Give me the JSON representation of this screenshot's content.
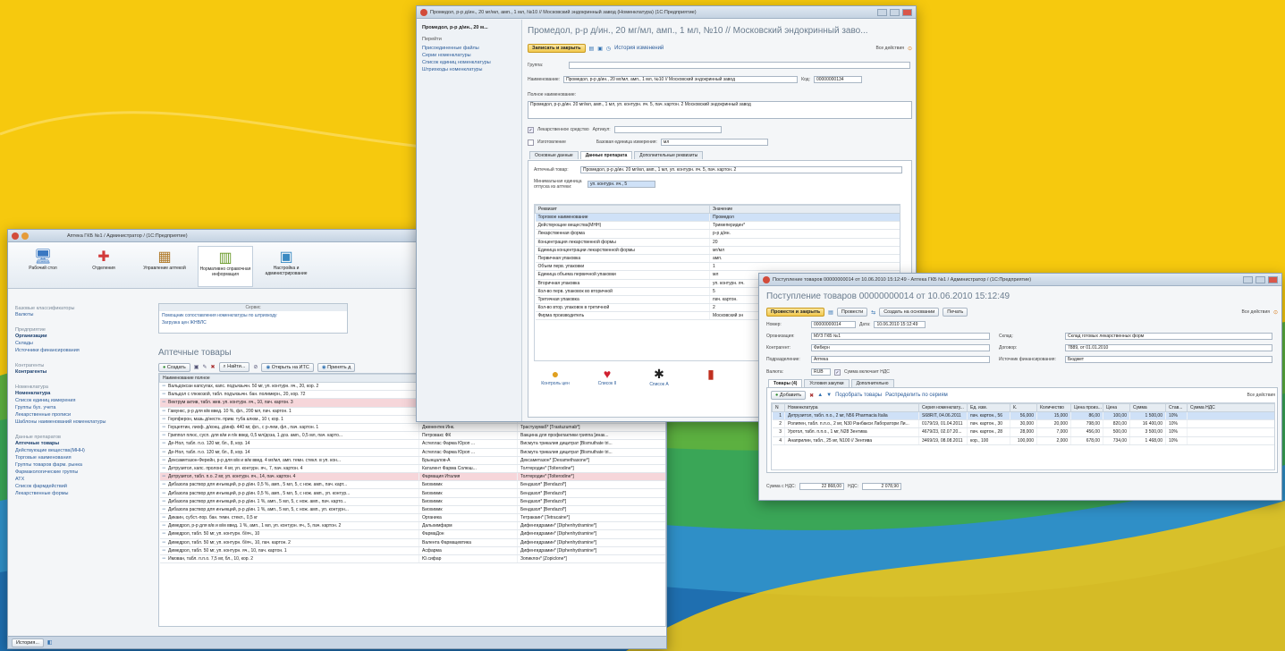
{
  "colors": {
    "bg_yellow": "#f6c90e",
    "bg_green": "#3aa657",
    "bg_blue": "#2f8fc7",
    "selection": "#cfe1f7",
    "pink_row": "#f6d6da"
  },
  "win1": {
    "title": "Аптека ГКБ №1 / Администратор / (1С:Предприятие)",
    "sections": [
      {
        "label": "Рабочий стол",
        "icon": "desktop-icon"
      },
      {
        "label": "Отделения",
        "icon": "medical-cross-icon"
      },
      {
        "label": "Управление аптекой",
        "icon": "boxes-icon"
      },
      {
        "label": "Нормативно справочная информация",
        "icon": "books-icon"
      },
      {
        "label": "Настройка и администрирование",
        "icon": "server-icon"
      }
    ],
    "servis": {
      "title": "Сервис",
      "items": [
        "Помощник сопоставления номенклатуры по штрихкоду",
        "Загрузка цен ЖНВЛС"
      ]
    },
    "sidebar": {
      "groups": [
        {
          "header": "Базовые классификаторы",
          "items": [
            {
              "label": "Валюты",
              "bold": false
            }
          ]
        },
        {
          "header": "Предприятие",
          "items": [
            {
              "label": "Организации",
              "bold": true
            },
            {
              "label": "Склады",
              "bold": false
            },
            {
              "label": "Источники финансирования",
              "bold": false
            }
          ]
        },
        {
          "header": "Контрагенты",
          "items": [
            {
              "label": "Контрагенты",
              "bold": true
            }
          ]
        },
        {
          "header": "Номенклатура",
          "items": [
            {
              "label": "Номенклатура",
              "bold": true
            },
            {
              "label": "Список единиц измерения",
              "bold": false
            },
            {
              "label": "Группы бух. учета",
              "bold": false
            },
            {
              "label": "Лекарственные прописи",
              "bold": false
            },
            {
              "label": "Шаблоны наименований номенклатуры",
              "bold": false
            }
          ]
        },
        {
          "header": "Данные препаратов",
          "items": [
            {
              "label": "Аптечные товары",
              "bold": true
            },
            {
              "label": "Действующие вещества(МНН)",
              "bold": false
            },
            {
              "label": "Торговые наименования",
              "bold": false
            },
            {
              "label": "Группы товаров фарм. рынка",
              "bold": false
            },
            {
              "label": "Фармакологические группы",
              "bold": false
            },
            {
              "label": "АТХ",
              "bold": false
            },
            {
              "label": "Список фармдействий",
              "bold": false
            },
            {
              "label": "Лекарственные формы",
              "bold": false
            }
          ]
        }
      ]
    },
    "list_title": "Аптечные товары",
    "toolbar": {
      "create": "Создать",
      "find": "Найти...",
      "open_its": "Открыть на ИТС",
      "accept": "Принять д"
    },
    "columns": [
      "Наименование полное",
      "",
      ""
    ],
    "rows": [
      {
        "name": "Вальдоксан капсулах, капс. подъязычн. 50 мг, уп. контурн. яч., 20, кор. 2",
        "maker": "",
        "trade": "",
        "style": ""
      },
      {
        "name": "Вальдол с глюкозой, табл. подъязычн. бан. полимерн., 20, кор. 72",
        "maker": "Уралбиофарм ОАО",
        "trade": "Левоментола раствор в ментил изовале...",
        "style": ""
      },
      {
        "name": "Вектрум актив, табл. жев. уп. контурн. яч., 10, пач. картон. 3",
        "maker": "Акрихин",
        "trade": "Поливитамины [Multivitamins]",
        "style": "pink"
      },
      {
        "name": "Гамункс, р-р для в/в введ. 10 %, фл., 200 мл, пач. картон. 1",
        "maker": "Талекрис Биотерапьютн...",
        "trade": "Иммуноглобулин человека нормальный [...",
        "style": ""
      },
      {
        "name": "Герпферон, мазь д/нестн. прим. туба алюм., 10 г, кор. 1",
        "maker": "ФирнМ",
        "trade": "",
        "style": ""
      },
      {
        "name": "Герцептин, лиоф. д/конц. д/инф. 440 мг, фл., с р-лем, фл., пач. картон. 1",
        "maker": "Дженентек Инк.",
        "trade": "Трастузумаб* [Trastuzumab*]",
        "style": ""
      },
      {
        "name": "Гриппол плюс, сусп. для в/м и п/к введ. 0,5 мл/доза, 1 доз. амп., 0,5 мл, пач. карто...",
        "maker": "Петровакс ФК",
        "trade": "Вакцина для профилактики гриппа [инак...",
        "style": ""
      },
      {
        "name": "Де-Нол, табл. п.о. 120 мг, бл., 8, кор. 14",
        "maker": "Астеллас Фарма Юроп ...",
        "trade": "Висмута трикалия дицитрат [Bismuthate tri...",
        "style": ""
      },
      {
        "name": "Де-Нол, табл. п.о. 120 мг, бл., 8, кор. 14",
        "maker": "Астеллас Фарма Юроп ...",
        "trade": "Висмута трикалия дицитрат [Bismuthate tri...",
        "style": ""
      },
      {
        "name": "Дексаметазон-Ферейн, р-р для в/в и в/м введ. 4 мг/мл, амп. темн. стекл. в уп. кон...",
        "maker": "Брынцалов-А",
        "trade": "Дексаметазон* [Dexamethasone*]",
        "style": ""
      },
      {
        "name": "Детрузитол, капс. пролонг. 4 мг, уп. контурн. яч., 7, пач. картон. 4",
        "maker": "Каталент Фарма Солюш...",
        "trade": "Толтеродин* [Tolterodine*]",
        "style": ""
      },
      {
        "name": "Детрузитол, табл. п.о. 2 мг, уп. контурн. яч., 14, пач. картон. 4",
        "maker": "Фармация Италия",
        "trade": "Толтеродин* [Tolterodine*]",
        "style": "pink"
      },
      {
        "name": "Дибазола раствор для инъекций, р-р д/ин. 0,5 %, амп., 5 мл, 5, с нож. амп., пач. карт...",
        "maker": "Биохимик",
        "trade": "Бендазол* [Bendazol*]",
        "style": ""
      },
      {
        "name": "Дибазола раствор для инъекций, р-р д/ин. 0,5 %, амп., 5 мл, 5, с нож. амп., уп. контур...",
        "maker": "Биохимик",
        "trade": "Бендазол* [Bendazol*]",
        "style": ""
      },
      {
        "name": "Дибазола раствор для инъекций, р-р д/ин. 1 %, амп., 5 мл, 5, с нож. амп., пач. карто...",
        "maker": "Биохимик",
        "trade": "Бендазол* [Bendazol*]",
        "style": ""
      },
      {
        "name": "Дибазола раствор для инъекций, р-р д/ин. 1 %, амп., 5 мл, 5, с нож. амп., уп. контурн...",
        "maker": "Биохимик",
        "trade": "Бендазол* [Bendazol*]",
        "style": ""
      },
      {
        "name": "Дикаин, субст.-пор. бан. темн. стекл., 0,5 кг",
        "maker": "Органика",
        "trade": "Тетракаин* [Tetracaine*]",
        "style": ""
      },
      {
        "name": "Димедрол, р-р для в/в и в/м введ. 1 %, амп., 1 мл, уп. контурн. яч., 5, пач. картон. 2",
        "maker": "Дальхимфарм",
        "trade": "Дифенгидрамин* [Diphenhydramine*]",
        "style": ""
      },
      {
        "name": "Димедрол, табл. 50 мг, уп. контурн. б/яч., 10",
        "maker": "ФармаДон",
        "trade": "Дифенгидрамин* [Diphenhydramine*]",
        "style": ""
      },
      {
        "name": "Димедрол, табл. 50 мг, уп. контурн. б/яч., 10, пач. картон. 2",
        "maker": "Валента Фармацевтика",
        "trade": "Дифенгидрамин* [Diphenhydramine*]",
        "style": ""
      },
      {
        "name": "Димедрол, табл. 50 мг, уп. контурн. яч., 10, пач. картон. 1",
        "maker": "Асфарма",
        "trade": "Дифенгидрамин* [Diphenhydramine*]",
        "style": ""
      },
      {
        "name": "Имован, табл. п.п.о. 7,5 мг, бл., 10, кор. 2",
        "maker": "Ю.сифар",
        "trade": "Зопиклон* [Zopiclone*]",
        "style": ""
      }
    ],
    "history_button": "История..."
  },
  "win2": {
    "title": "Промедол, р-р д/ин., 20 мг/мл, амп., 1 мл, №10 // Московский эндокринный завод (Номенклатура) (1С:Предприятие)",
    "side_title": "Промедол, р-р д/ин., 20 м...",
    "side_links": [
      "Перейти",
      "Присоединенные файлы",
      "Серии номенклатуры",
      "Список единиц номенклатуры",
      "Штрихкоды номенклатуры"
    ],
    "heading": "Промедол, р-р д/ин., 20 мг/мл, амп., 1 мл, №10 // Московский эндокринный заво...",
    "save_close": "Записать и закрыть",
    "history": "История изменений",
    "all_actions": "Все действия",
    "group_label": "Группа:",
    "name_label": "Наименование:",
    "name_value": "Промедол, р-р д/ин., 20 мг/мл, амп., 1 мл, №10 // Московский эндокринный завод",
    "code_label": "Код:",
    "code_value": "00000000134",
    "full_name_label": "Полное наименование:",
    "full_name_value": "Промедол, р-р д/ин. 20 мг/мл, амп., 1 мл, уп. контурн. яч. 5, пач. картон. 2 Московский эндокринный завод",
    "drug_checkbox": "Лекарственное средство",
    "article_label": "Артикул:",
    "manufacture_checkbox": "Изготовление",
    "base_unit_label": "Базовая единица измерения:",
    "base_unit_value": "мл",
    "tabs": [
      "Основные данные",
      "Данные препарата",
      "Дополнительные реквизиты"
    ],
    "pharm_item_label": "Аптечный товар:",
    "pharm_item_value": "Промедол, р-р д/ин. 20 мг/мл, амп., 1 мл, уп. контурн. яч. 5, пач. картон. 2",
    "min_unit_label": "Минимальная единица отпуска из аптеки:",
    "min_unit_value": "уп. контурн. яч., 5",
    "props_columns": [
      "Реквизит",
      "Значение"
    ],
    "props": [
      {
        "k": "Торговое наименование",
        "v": "Промедол",
        "sel": true
      },
      {
        "k": "Действующие вещества(МНН)",
        "v": "Тримеперидин*",
        "sel": false
      },
      {
        "k": "Лекарственная форма",
        "v": "р-р д/ин.",
        "sel": false
      },
      {
        "k": "Концентрация лекарственной формы",
        "v": "20",
        "sel": false
      },
      {
        "k": "Единица концентрации лекарственной формы",
        "v": "мг/мл",
        "sel": false
      },
      {
        "k": "Первичная упаковка",
        "v": "амп.",
        "sel": false
      },
      {
        "k": "Объем перв. упаковки",
        "v": "1",
        "sel": false
      },
      {
        "k": "Единица объема первичной упаковки",
        "v": "мл",
        "sel": false
      },
      {
        "k": "Вторичная упаковка",
        "v": "уп. контурн. яч.",
        "sel": false
      },
      {
        "k": "Кол-во перв. упаковок во вторичной",
        "v": "5",
        "sel": false
      },
      {
        "k": "Третичная упаковка",
        "v": "пач. картон.",
        "sel": false
      },
      {
        "k": "Кол-во втор. упаковок в третичной",
        "v": "2",
        "sel": false
      },
      {
        "k": "Фирма производитель",
        "v": "Московский эн",
        "sel": false
      }
    ],
    "bottom_icons": [
      {
        "icon": "pill-icon",
        "label": "Контроль цен"
      },
      {
        "icon": "heart-icon",
        "label": "Список II"
      },
      {
        "icon": "bug-icon",
        "label": "Список А"
      },
      {
        "icon": "bottle-icon",
        "label": ""
      }
    ]
  },
  "win3": {
    "title": "Поступление товаров 00000000014 от 10.06.2010 15:12:49 - Аптека ГКБ №1 / Администратор / (1С:Предприятие)",
    "heading": "Поступление товаров 00000000014 от 10.06.2010 15:12:49",
    "post_close": "Провести и закрыть",
    "post": "Провести",
    "create_based": "Создать на основании",
    "print": "Печать",
    "all_actions": "Все действия",
    "number_label": "Номер:",
    "number_value": "00000000014",
    "date_label": "Дата:",
    "date_value": "10.06.2010 15:12:49",
    "org_label": "Организация:",
    "org_value": "МУЗ ГКБ №1",
    "warehouse_label": "Склад:",
    "warehouse_value": "Склад готовых лекарственных форм",
    "contractor_label": "Контрагент:",
    "contractor_value": "Фиберн",
    "contract_label": "Договор:",
    "contract_value": "7889, от 01.01.2010",
    "dept_label": "Подразделение:",
    "dept_value": "Аптека",
    "fin_label": "Источник финансирования:",
    "fin_value": "Бюджет",
    "currency_label": "Валюта:",
    "currency_value": "RUB",
    "vat_incl": "Сумма включает НДС",
    "tabs": [
      "Товары (4)",
      "Условия закупки",
      "Дополнительно"
    ],
    "goods_toolbar": {
      "add": "Добавить",
      "pick": "Подобрать товары",
      "distribute": "Распределить по сериям",
      "all": "Все действия"
    },
    "columns": [
      "N",
      "Номенклатура",
      "Серия номенклату...",
      "Ед. изм.",
      "К.",
      "Количество",
      "Цена произ...",
      "Цена",
      "Сумма",
      "Став...",
      "Сумма НДС"
    ],
    "rows": [
      {
        "n": "1",
        "name": "Детрузитол, табл. п.о., 2 мг, N56 Pharmacia Italia",
        "series": "S68RIT, 04.06.2011",
        "unit": "пач. картон., 56",
        "k": "56,000",
        "qty": "15,000",
        "mprice": "86,00",
        "price": "100,00",
        "sum": "1 500,00",
        "rate": "10%",
        "vat": "",
        "sel": true
      },
      {
        "n": "2",
        "name": "Ролипен, табл. п.п.о., 2 мг, N30 Ранбакси Лаборатори Ли...",
        "series": "0179/19, 01.04.2011",
        "unit": "пач. картон., 30",
        "k": "30,000",
        "qty": "20,000",
        "mprice": "798,00",
        "price": "820,00",
        "sum": "16 400,00",
        "rate": "10%",
        "vat": "",
        "sel": false
      },
      {
        "n": "3",
        "name": "Уротол, табл. п.п.о., 1 мг, N28 Зентива",
        "series": "4679/23, 02.07.20...",
        "unit": "пач. картон., 28",
        "k": "28,000",
        "qty": "7,000",
        "mprice": "456,00",
        "price": "500,00",
        "sum": "3 500,00",
        "rate": "10%",
        "vat": "",
        "sel": false
      },
      {
        "n": "4",
        "name": "Анаприлин, табл., 25 мг, N100 // Зентива",
        "series": "3469/19, 08.08.2011",
        "unit": "кор., 100",
        "k": "100,000",
        "qty": "2,000",
        "mprice": "678,00",
        "price": "734,00",
        "sum": "1 468,00",
        "rate": "10%",
        "vat": "",
        "sel": false
      }
    ],
    "total_label": "Сумма с НДС:",
    "total_value": "22 868,00",
    "vat_label": "НДС:",
    "vat_value": "2 078,90"
  }
}
